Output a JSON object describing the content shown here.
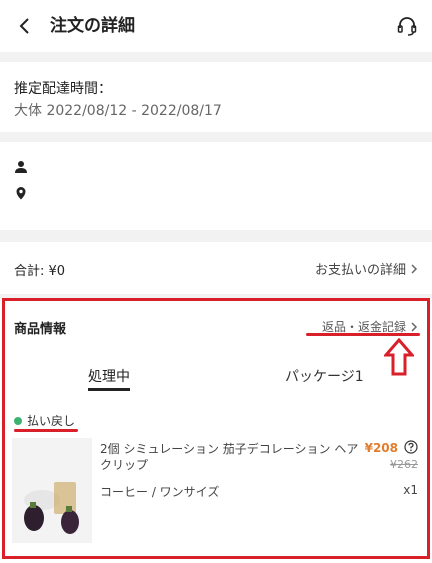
{
  "header": {
    "title": "注文の詳細",
    "back_icon": "chevron-left-icon",
    "support_icon": "headset-icon"
  },
  "delivery": {
    "label": "推定配達時間：",
    "value": "大体 2022/08/12 - 2022/08/17"
  },
  "address": {
    "person_icon": "person-icon",
    "location_icon": "location-pin-icon"
  },
  "summary": {
    "total_label": "合計: ¥0",
    "payment_detail_label": "お支払いの詳細"
  },
  "products": {
    "section_title": "商品情報",
    "return_record_label": "返品・返金記録",
    "tabs": [
      {
        "label": "処理中",
        "active": true
      },
      {
        "label": "パッケージ1",
        "active": false
      }
    ],
    "status": {
      "label": "払い戻し",
      "color": "#3cb371"
    },
    "item": {
      "name": "2個 シミュレーション 茄子デコレーション ヘアクリップ",
      "price": "¥208",
      "original_price": "¥262",
      "variant": "コーヒー / ワンサイズ",
      "quantity": "x1"
    }
  },
  "colors": {
    "annotation_red": "#d91f2a",
    "price_orange": "#e07d2f"
  }
}
